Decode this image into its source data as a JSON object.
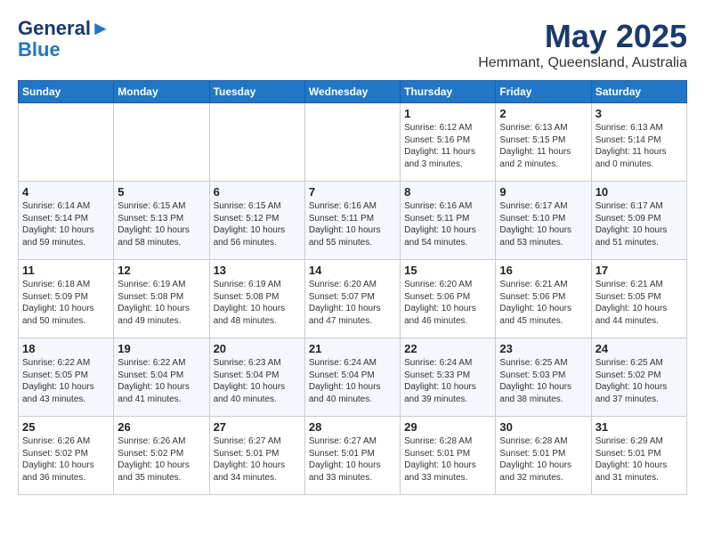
{
  "header": {
    "logo_line1": "General",
    "logo_line2": "Blue",
    "month_title": "May 2025",
    "location": "Hemmant, Queensland, Australia"
  },
  "weekdays": [
    "Sunday",
    "Monday",
    "Tuesday",
    "Wednesday",
    "Thursday",
    "Friday",
    "Saturday"
  ],
  "weeks": [
    [
      {
        "day": "",
        "empty": true
      },
      {
        "day": "",
        "empty": true
      },
      {
        "day": "",
        "empty": true
      },
      {
        "day": "",
        "empty": true
      },
      {
        "day": "1",
        "sunrise": "6:12 AM",
        "sunset": "5:16 PM",
        "daylight": "11 hours and 3 minutes."
      },
      {
        "day": "2",
        "sunrise": "6:13 AM",
        "sunset": "5:15 PM",
        "daylight": "11 hours and 2 minutes."
      },
      {
        "day": "3",
        "sunrise": "6:13 AM",
        "sunset": "5:14 PM",
        "daylight": "11 hours and 0 minutes."
      }
    ],
    [
      {
        "day": "4",
        "sunrise": "6:14 AM",
        "sunset": "5:14 PM",
        "daylight": "10 hours and 59 minutes."
      },
      {
        "day": "5",
        "sunrise": "6:15 AM",
        "sunset": "5:13 PM",
        "daylight": "10 hours and 58 minutes."
      },
      {
        "day": "6",
        "sunrise": "6:15 AM",
        "sunset": "5:12 PM",
        "daylight": "10 hours and 56 minutes."
      },
      {
        "day": "7",
        "sunrise": "6:16 AM",
        "sunset": "5:11 PM",
        "daylight": "10 hours and 55 minutes."
      },
      {
        "day": "8",
        "sunrise": "6:16 AM",
        "sunset": "5:11 PM",
        "daylight": "10 hours and 54 minutes."
      },
      {
        "day": "9",
        "sunrise": "6:17 AM",
        "sunset": "5:10 PM",
        "daylight": "10 hours and 53 minutes."
      },
      {
        "day": "10",
        "sunrise": "6:17 AM",
        "sunset": "5:09 PM",
        "daylight": "10 hours and 51 minutes."
      }
    ],
    [
      {
        "day": "11",
        "sunrise": "6:18 AM",
        "sunset": "5:09 PM",
        "daylight": "10 hours and 50 minutes."
      },
      {
        "day": "12",
        "sunrise": "6:19 AM",
        "sunset": "5:08 PM",
        "daylight": "10 hours and 49 minutes."
      },
      {
        "day": "13",
        "sunrise": "6:19 AM",
        "sunset": "5:08 PM",
        "daylight": "10 hours and 48 minutes."
      },
      {
        "day": "14",
        "sunrise": "6:20 AM",
        "sunset": "5:07 PM",
        "daylight": "10 hours and 47 minutes."
      },
      {
        "day": "15",
        "sunrise": "6:20 AM",
        "sunset": "5:06 PM",
        "daylight": "10 hours and 46 minutes."
      },
      {
        "day": "16",
        "sunrise": "6:21 AM",
        "sunset": "5:06 PM",
        "daylight": "10 hours and 45 minutes."
      },
      {
        "day": "17",
        "sunrise": "6:21 AM",
        "sunset": "5:05 PM",
        "daylight": "10 hours and 44 minutes."
      }
    ],
    [
      {
        "day": "18",
        "sunrise": "6:22 AM",
        "sunset": "5:05 PM",
        "daylight": "10 hours and 43 minutes."
      },
      {
        "day": "19",
        "sunrise": "6:22 AM",
        "sunset": "5:04 PM",
        "daylight": "10 hours and 41 minutes."
      },
      {
        "day": "20",
        "sunrise": "6:23 AM",
        "sunset": "5:04 PM",
        "daylight": "10 hours and 40 minutes."
      },
      {
        "day": "21",
        "sunrise": "6:24 AM",
        "sunset": "5:04 PM",
        "daylight": "10 hours and 40 minutes."
      },
      {
        "day": "22",
        "sunrise": "6:24 AM",
        "sunset": "5:33 PM",
        "daylight": "10 hours and 39 minutes."
      },
      {
        "day": "23",
        "sunrise": "6:25 AM",
        "sunset": "5:03 PM",
        "daylight": "10 hours and 38 minutes."
      },
      {
        "day": "24",
        "sunrise": "6:25 AM",
        "sunset": "5:02 PM",
        "daylight": "10 hours and 37 minutes."
      }
    ],
    [
      {
        "day": "25",
        "sunrise": "6:26 AM",
        "sunset": "5:02 PM",
        "daylight": "10 hours and 36 minutes."
      },
      {
        "day": "26",
        "sunrise": "6:26 AM",
        "sunset": "5:02 PM",
        "daylight": "10 hours and 35 minutes."
      },
      {
        "day": "27",
        "sunrise": "6:27 AM",
        "sunset": "5:01 PM",
        "daylight": "10 hours and 34 minutes."
      },
      {
        "day": "28",
        "sunrise": "6:27 AM",
        "sunset": "5:01 PM",
        "daylight": "10 hours and 33 minutes."
      },
      {
        "day": "29",
        "sunrise": "6:28 AM",
        "sunset": "5:01 PM",
        "daylight": "10 hours and 33 minutes."
      },
      {
        "day": "30",
        "sunrise": "6:28 AM",
        "sunset": "5:01 PM",
        "daylight": "10 hours and 32 minutes."
      },
      {
        "day": "31",
        "sunrise": "6:29 AM",
        "sunset": "5:01 PM",
        "daylight": "10 hours and 31 minutes."
      }
    ]
  ],
  "labels": {
    "sunrise_prefix": "Sunrise: ",
    "sunset_prefix": "Sunset: ",
    "daylight_prefix": "Daylight: "
  }
}
